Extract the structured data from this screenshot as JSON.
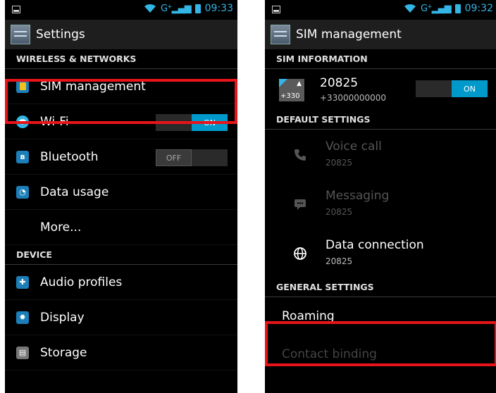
{
  "left": {
    "status": {
      "network": "G",
      "time": "09:33"
    },
    "action_bar": {
      "title": "Settings"
    },
    "sections": {
      "wireless": "WIRELESS & NETWORKS",
      "device": "DEVICE"
    },
    "items": {
      "sim": "SIM management",
      "wifi": "Wi-Fi",
      "bluetooth": "Bluetooth",
      "data_usage": "Data usage",
      "more": "More...",
      "audio": "Audio profiles",
      "display": "Display",
      "storage": "Storage"
    },
    "wifi_toggle": {
      "state": "ON"
    },
    "bt_toggle": {
      "state": "OFF"
    }
  },
  "right": {
    "status": {
      "network": "G",
      "time": "09:32"
    },
    "action_bar": {
      "title": "SIM management"
    },
    "sections": {
      "sim_info": "SIM INFORMATION",
      "default": "DEFAULT SETTINGS",
      "general": "GENERAL SETTINGS"
    },
    "sim": {
      "badge_number": "+330",
      "name": "20825",
      "number": "+33000000000",
      "toggle": "ON"
    },
    "defaults": {
      "voice": {
        "label": "Voice call",
        "value": "20825"
      },
      "messaging": {
        "label": "Messaging",
        "value": "20825"
      },
      "data": {
        "label": "Data connection",
        "value": "20825"
      }
    },
    "general": {
      "roaming": "Roaming",
      "contact_binding": "Contact binding"
    }
  },
  "colors": {
    "accent": "#33b5e5",
    "toggle_on": "#0099cc",
    "highlight": "#e8141a"
  }
}
